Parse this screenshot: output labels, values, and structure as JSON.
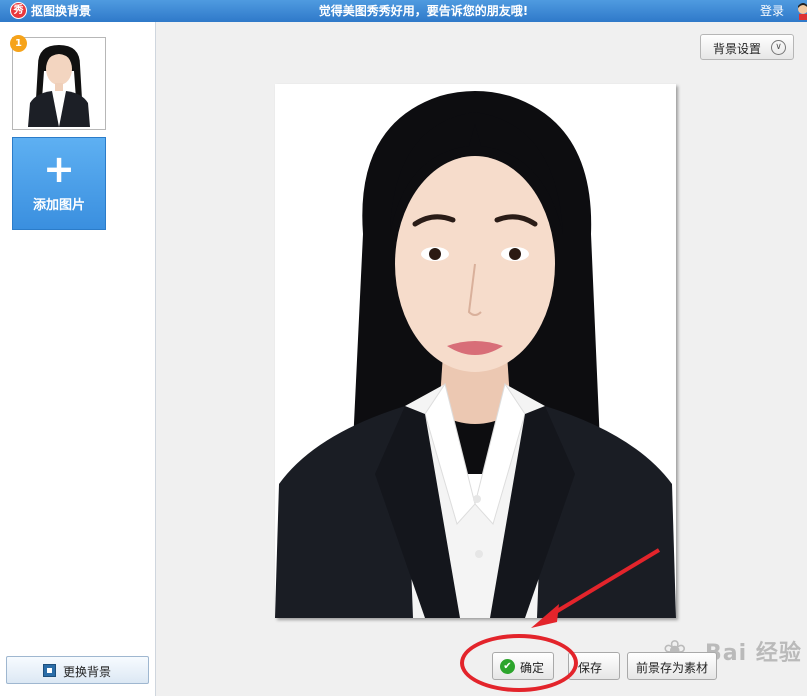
{
  "titlebar": {
    "logo_text": "秀",
    "app_title": "抠图换背景",
    "slogan": "觉得美图秀秀好用，要告诉您的朋友哦!",
    "login_label": "登录"
  },
  "sidebar": {
    "thumbnail_badge": "1",
    "add_image_label": "添加图片",
    "add_image_icon": "plus-icon",
    "change_background_label": "更换背景"
  },
  "toolbar": {
    "background_settings_label": "背景设置"
  },
  "actions": {
    "ok_label": "确定",
    "save_label": "保存",
    "save_as_material_label": "前景存为素材"
  },
  "watermark": {
    "text": "Bai 经验"
  },
  "colors": {
    "titlebar": "#2f79c9",
    "accent_button": "#3a8fdf",
    "annotation_red": "#e3242b",
    "check_green": "#2ca52c"
  }
}
